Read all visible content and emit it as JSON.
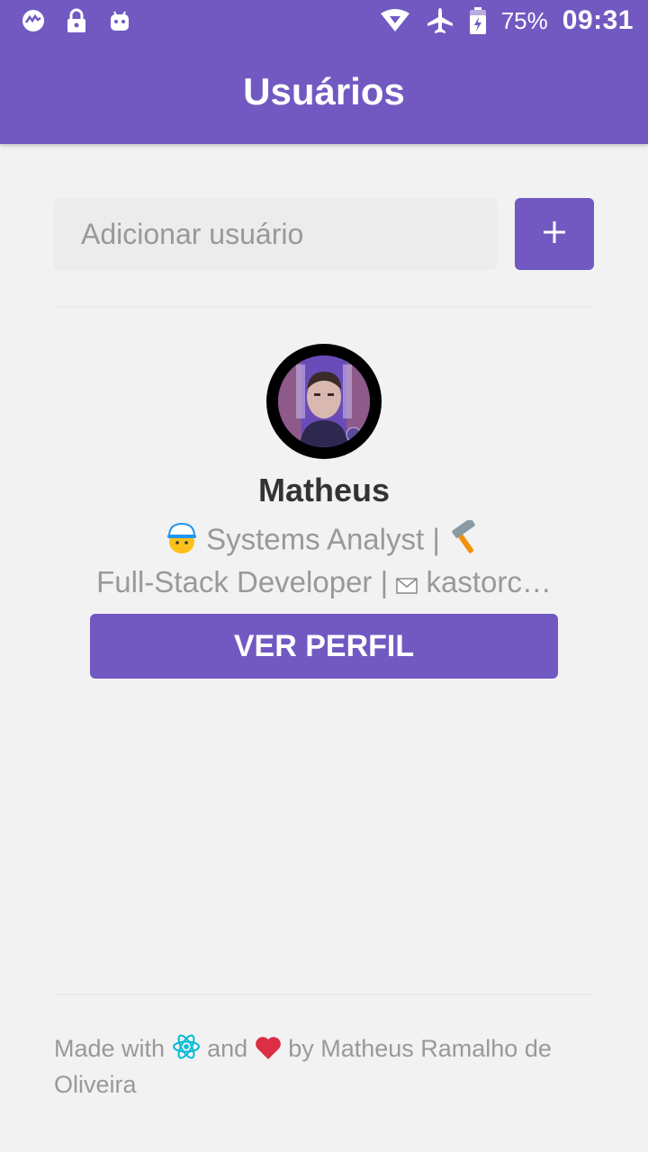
{
  "status_bar": {
    "icons_left": [
      "speedometer-icon",
      "lock-icon",
      "android-icon"
    ],
    "icons_right": [
      "wifi-icon",
      "airplane-mode-icon",
      "battery-charging-icon"
    ],
    "battery": "75%",
    "time": "09:31"
  },
  "appbar": {
    "title": "Usuários"
  },
  "form": {
    "placeholder": "Adicionar usuário",
    "value": "",
    "add_icon": "plus-icon"
  },
  "user": {
    "name": "Matheus",
    "bio_line1": "Systems Analyst |",
    "bio_line2_a": "Full-Stack Developer |",
    "bio_line2_b": "kastorc…",
    "bio_icons": [
      "construction-worker-icon",
      "hammer-icon",
      "envelope-icon"
    ],
    "button_label": "VER PERFIL"
  },
  "footer": {
    "part1": "Made with",
    "part2": "and",
    "part3": "by Matheus Ramalho de Oliveira",
    "icons": [
      "react-icon",
      "heart-icon"
    ]
  },
  "colors": {
    "primary": "#7159c1",
    "background": "#f2f2f2",
    "input_bg": "#ececec",
    "text_dark": "#333333",
    "text_muted": "#999999",
    "heart": "#dd2e44",
    "react": "#00bcd4"
  }
}
